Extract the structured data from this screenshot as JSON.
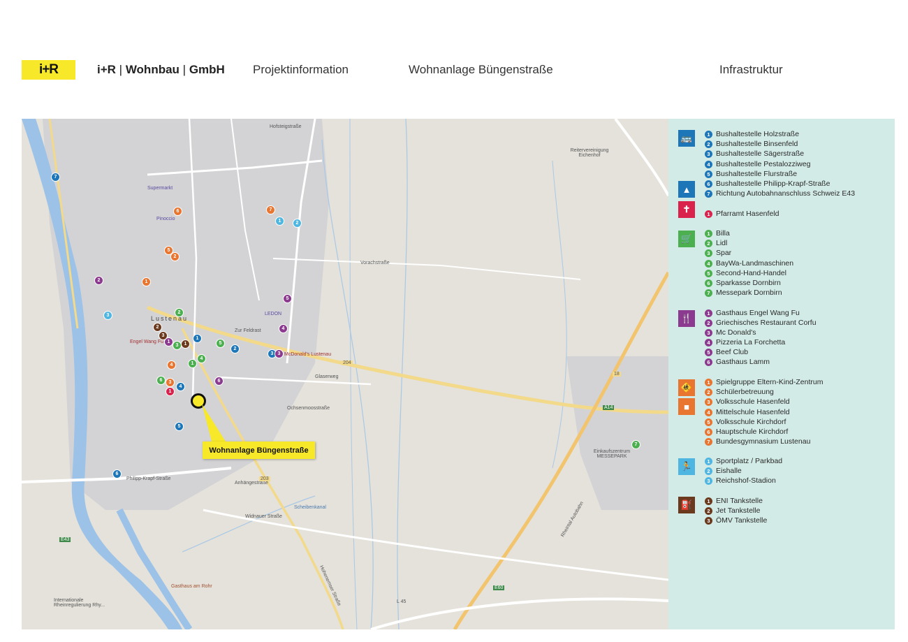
{
  "header": {
    "logo_text": "i+R",
    "company_bold1": "i+R",
    "company_sep1": " | ",
    "company_bold2": "Wohnbau",
    "company_sep2": " | ",
    "company_bold3": "GmbH",
    "nav_project_info": "Projektinformation",
    "nav_property": "Wohnanlage Büngenstraße",
    "nav_infrastructure": "Infrastruktur"
  },
  "map": {
    "marker_label": "Wohnanlage Büngenstraße",
    "place_labels": [
      "Lustenau",
      "Supermarkt",
      "Pinoccio",
      "LEDON",
      "Engel Wang Fu",
      "McDonald's Lustenau",
      "Reitervereinigung Eichenhof",
      "Einkaufszentrum MESSEPARK",
      "Gasthaus am Rohr",
      "Internationale Rheinregulierung Rhy..."
    ],
    "road_labels": [
      "Vorachstraße",
      "Glaserweg",
      "Hofsteigstraße",
      "Philipp-Krapf-Straße",
      "Widnauer Straße",
      "Scheibenkanal",
      "Rheintal Autobahn",
      "Hohenemser Straße",
      "Anhängestraße",
      "Ochsenmoosstraße",
      "Zur Feldrast",
      "L 45"
    ],
    "road_numbers": [
      "204",
      "203",
      "E43",
      "E60",
      "A14",
      "18"
    ]
  },
  "legend": {
    "colors": {
      "bus": "#1d76b8",
      "church": "#d9234c",
      "shop": "#4caf50",
      "food": "#8b3a8f",
      "school": "#e87530",
      "sport": "#4fb6e1",
      "fuel": "#6b3a1e"
    },
    "categories": [
      {
        "icon": "bus-icon",
        "items": [
          "Bushaltestelle Holzstraße",
          "Bushaltestelle Binsenfeld",
          "Bushaltestelle Sägerstraße",
          "Bushaltestelle Pestalozziweg",
          "Bushaltestelle Flurstraße",
          "Bushaltestelle Philipp-Krapf-Straße",
          "Richtung Autobahnanschluss Schweiz E43"
        ]
      },
      {
        "icon": "church-icon",
        "items": [
          "Pfarramt Hasenfeld"
        ]
      },
      {
        "icon": "shopping-cart-icon",
        "items": [
          "Billa",
          "Lidl",
          "Spar",
          "BayWa-Landmaschinen",
          "Second-Hand-Handel",
          "Sparkasse Dornbirn",
          "Messepark Dornbirn"
        ]
      },
      {
        "icon": "restaurant-icon",
        "items": [
          "Gasthaus Engel Wang Fu",
          "Griechisches Restaurant Corfu",
          "Mc Donald's",
          "Pizzeria La Forchetta",
          "Beef Club",
          "Gasthaus Lamm"
        ]
      },
      {
        "icon": "school-icon",
        "items": [
          "Spielgruppe Eltern-Kind-Zentrum",
          "Schülerbetreuung",
          "Volksschule Hasenfeld",
          "Mittelschule Hasenfeld",
          "Volksschule Kirchdorf",
          "Hauptschule Kirchdorf",
          "Bundesgymnasium Lustenau"
        ]
      },
      {
        "icon": "sport-icon",
        "items": [
          "Sportplatz / Parkbad",
          "Eishalle",
          "Reichshof-Stadion"
        ]
      },
      {
        "icon": "fuel-icon",
        "items": [
          "ENI Tankstelle",
          "Jet Tankstelle",
          "ÖMV Tankstelle"
        ]
      }
    ]
  }
}
